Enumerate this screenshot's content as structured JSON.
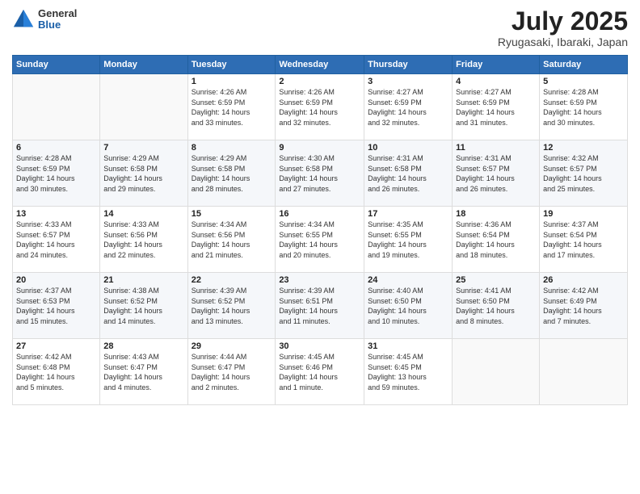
{
  "logo": {
    "general": "General",
    "blue": "Blue"
  },
  "header": {
    "month": "July 2025",
    "location": "Ryugasaki, Ibaraki, Japan"
  },
  "weekdays": [
    "Sunday",
    "Monday",
    "Tuesday",
    "Wednesday",
    "Thursday",
    "Friday",
    "Saturday"
  ],
  "weeks": [
    [
      {
        "day": "",
        "info": ""
      },
      {
        "day": "",
        "info": ""
      },
      {
        "day": "1",
        "info": "Sunrise: 4:26 AM\nSunset: 6:59 PM\nDaylight: 14 hours\nand 33 minutes."
      },
      {
        "day": "2",
        "info": "Sunrise: 4:26 AM\nSunset: 6:59 PM\nDaylight: 14 hours\nand 32 minutes."
      },
      {
        "day": "3",
        "info": "Sunrise: 4:27 AM\nSunset: 6:59 PM\nDaylight: 14 hours\nand 32 minutes."
      },
      {
        "day": "4",
        "info": "Sunrise: 4:27 AM\nSunset: 6:59 PM\nDaylight: 14 hours\nand 31 minutes."
      },
      {
        "day": "5",
        "info": "Sunrise: 4:28 AM\nSunset: 6:59 PM\nDaylight: 14 hours\nand 30 minutes."
      }
    ],
    [
      {
        "day": "6",
        "info": "Sunrise: 4:28 AM\nSunset: 6:59 PM\nDaylight: 14 hours\nand 30 minutes."
      },
      {
        "day": "7",
        "info": "Sunrise: 4:29 AM\nSunset: 6:58 PM\nDaylight: 14 hours\nand 29 minutes."
      },
      {
        "day": "8",
        "info": "Sunrise: 4:29 AM\nSunset: 6:58 PM\nDaylight: 14 hours\nand 28 minutes."
      },
      {
        "day": "9",
        "info": "Sunrise: 4:30 AM\nSunset: 6:58 PM\nDaylight: 14 hours\nand 27 minutes."
      },
      {
        "day": "10",
        "info": "Sunrise: 4:31 AM\nSunset: 6:58 PM\nDaylight: 14 hours\nand 26 minutes."
      },
      {
        "day": "11",
        "info": "Sunrise: 4:31 AM\nSunset: 6:57 PM\nDaylight: 14 hours\nand 26 minutes."
      },
      {
        "day": "12",
        "info": "Sunrise: 4:32 AM\nSunset: 6:57 PM\nDaylight: 14 hours\nand 25 minutes."
      }
    ],
    [
      {
        "day": "13",
        "info": "Sunrise: 4:33 AM\nSunset: 6:57 PM\nDaylight: 14 hours\nand 24 minutes."
      },
      {
        "day": "14",
        "info": "Sunrise: 4:33 AM\nSunset: 6:56 PM\nDaylight: 14 hours\nand 22 minutes."
      },
      {
        "day": "15",
        "info": "Sunrise: 4:34 AM\nSunset: 6:56 PM\nDaylight: 14 hours\nand 21 minutes."
      },
      {
        "day": "16",
        "info": "Sunrise: 4:34 AM\nSunset: 6:55 PM\nDaylight: 14 hours\nand 20 minutes."
      },
      {
        "day": "17",
        "info": "Sunrise: 4:35 AM\nSunset: 6:55 PM\nDaylight: 14 hours\nand 19 minutes."
      },
      {
        "day": "18",
        "info": "Sunrise: 4:36 AM\nSunset: 6:54 PM\nDaylight: 14 hours\nand 18 minutes."
      },
      {
        "day": "19",
        "info": "Sunrise: 4:37 AM\nSunset: 6:54 PM\nDaylight: 14 hours\nand 17 minutes."
      }
    ],
    [
      {
        "day": "20",
        "info": "Sunrise: 4:37 AM\nSunset: 6:53 PM\nDaylight: 14 hours\nand 15 minutes."
      },
      {
        "day": "21",
        "info": "Sunrise: 4:38 AM\nSunset: 6:52 PM\nDaylight: 14 hours\nand 14 minutes."
      },
      {
        "day": "22",
        "info": "Sunrise: 4:39 AM\nSunset: 6:52 PM\nDaylight: 14 hours\nand 13 minutes."
      },
      {
        "day": "23",
        "info": "Sunrise: 4:39 AM\nSunset: 6:51 PM\nDaylight: 14 hours\nand 11 minutes."
      },
      {
        "day": "24",
        "info": "Sunrise: 4:40 AM\nSunset: 6:50 PM\nDaylight: 14 hours\nand 10 minutes."
      },
      {
        "day": "25",
        "info": "Sunrise: 4:41 AM\nSunset: 6:50 PM\nDaylight: 14 hours\nand 8 minutes."
      },
      {
        "day": "26",
        "info": "Sunrise: 4:42 AM\nSunset: 6:49 PM\nDaylight: 14 hours\nand 7 minutes."
      }
    ],
    [
      {
        "day": "27",
        "info": "Sunrise: 4:42 AM\nSunset: 6:48 PM\nDaylight: 14 hours\nand 5 minutes."
      },
      {
        "day": "28",
        "info": "Sunrise: 4:43 AM\nSunset: 6:47 PM\nDaylight: 14 hours\nand 4 minutes."
      },
      {
        "day": "29",
        "info": "Sunrise: 4:44 AM\nSunset: 6:47 PM\nDaylight: 14 hours\nand 2 minutes."
      },
      {
        "day": "30",
        "info": "Sunrise: 4:45 AM\nSunset: 6:46 PM\nDaylight: 14 hours\nand 1 minute."
      },
      {
        "day": "31",
        "info": "Sunrise: 4:45 AM\nSunset: 6:45 PM\nDaylight: 13 hours\nand 59 minutes."
      },
      {
        "day": "",
        "info": ""
      },
      {
        "day": "",
        "info": ""
      }
    ]
  ]
}
